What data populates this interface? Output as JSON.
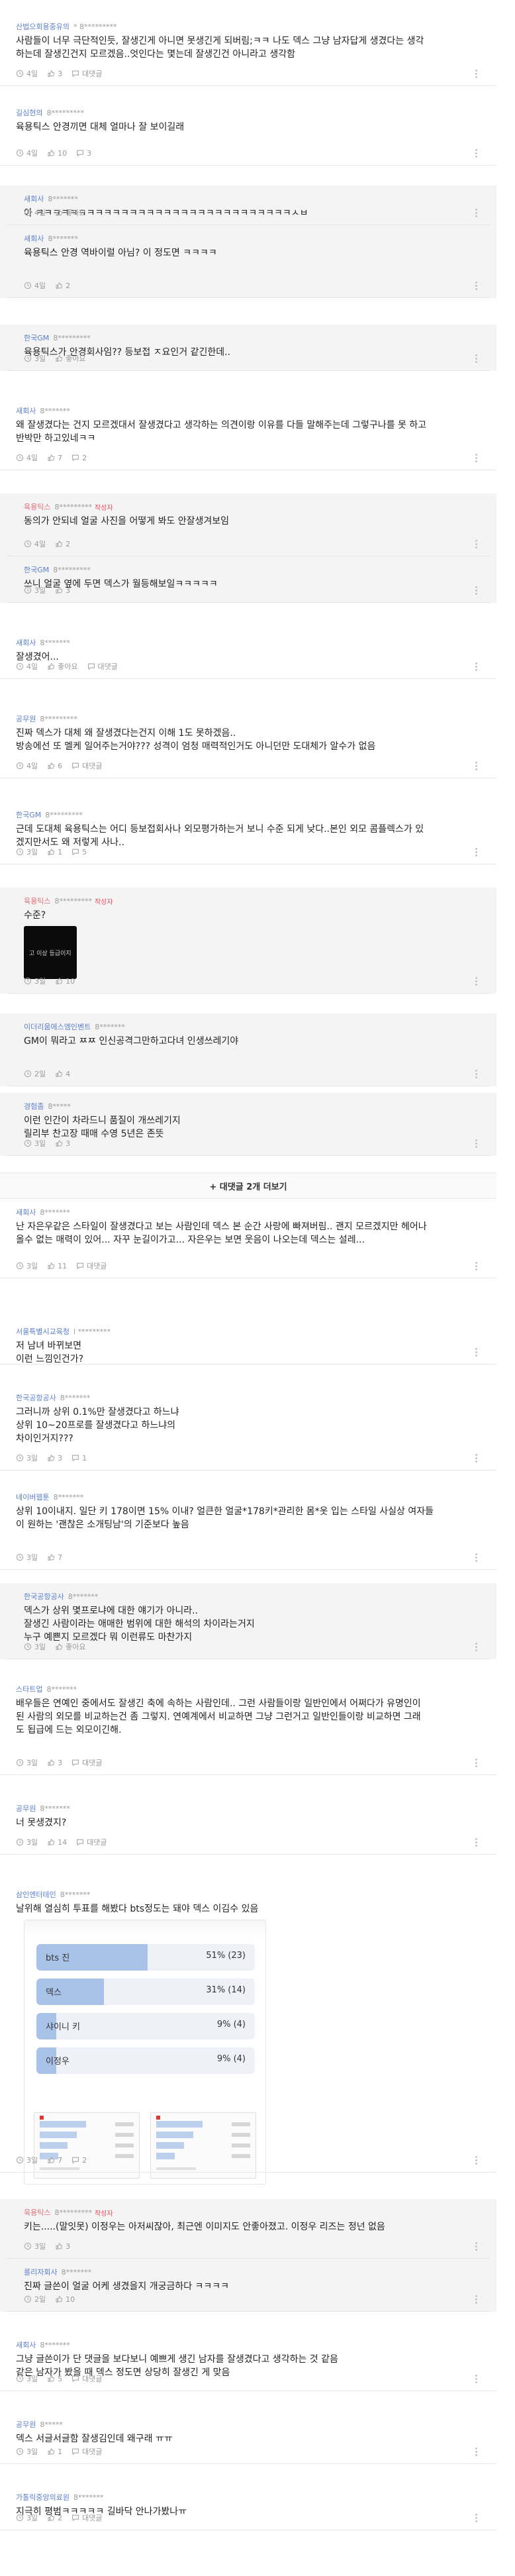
{
  "comments": [
    {
      "kind": "top",
      "nick": "산법으회용중유의",
      "memo": "* 8*********",
      "text": [
        "사람들이 너무 극단적인듯, 잘생긴게 아니면 못생긴게 되버림;ㅋㅋ 나도 덱스 그냥 남자답게 생겼다는 생각",
        "하는데 잘생긴건지 모르겠음..엇인다는 몇는데 잘생긴건 아니라고 생각함"
      ],
      "meta": {
        "time": "4일",
        "likes": "3",
        "reply": "대댓글"
      }
    },
    {
      "kind": "top",
      "nick": "길심현의",
      "memo": "8*********",
      "text": [
        "육용틱스 안경끼면 대체 얼마나 잘 보이길래"
      ],
      "meta": {
        "time": "4일",
        "likes": "10",
        "reply": "3"
      }
    },
    {
      "kind": "reply",
      "nick": "새회사",
      "memo": "8*******",
      "text": [
        "아 ㅋㅋㅋㅋㅋㅋㅋㅋㅋㅋㅋㅋㅋㅋㅋㅋㅋㅋㅋㅋㅋㅋㅋㅋㅋㅋㅋㅋㅋㅋㅅㅂ"
      ],
      "meta": {
        "time": "4일",
        "likes": "좋아요",
        "reply": ""
      }
    },
    {
      "kind": "reply",
      "nick": "새회사",
      "memo": "8*******",
      "text": [
        "육용틱스 안경 역바이럴 아님? 이 정도면 ㅋㅋㅋㅋ"
      ],
      "meta": {
        "time": "4일",
        "likes": "2",
        "reply": ""
      }
    },
    {
      "kind": "reply",
      "nick": "한국GM",
      "memo": "8*********",
      "text": [
        "육용틱스가 안경회사임?? 등보접 ㅈ요인거 같긴한데.."
      ],
      "meta": {
        "time": "3일",
        "likes": "좋아요",
        "reply": ""
      }
    },
    {
      "kind": "top",
      "nick": "새회사",
      "memo": "8*******",
      "text": [
        "왜 잘생겼다는 건지 모르겠대서 잘생겼다고 생각하는 의견이랑 이유를 다들 말해주는데 그렇구나를 못 하고",
        "반박만 하고있네ㅋㅋ"
      ],
      "meta": {
        "time": "4일",
        "likes": "7",
        "reply": "2"
      }
    },
    {
      "kind": "reply",
      "nick": "육용틱스",
      "memo": "8*********",
      "tag": "작성자",
      "text": [
        "동의가 안되네 얼굴 사진을 어떻게 봐도 안잘생겨보임"
      ],
      "meta": {
        "time": "4일",
        "likes": "2",
        "reply": ""
      }
    },
    {
      "kind": "reply",
      "nick": "한국GM",
      "memo": "8*********",
      "text": [
        "쓰니 얼굴 옆에 두면 덱스가 월등해보일ㅋㅋㅋㅋㅋ"
      ],
      "meta": {
        "time": "3일",
        "likes": "3",
        "reply": ""
      }
    },
    {
      "kind": "top",
      "nick": "새회사",
      "memo": "8*******",
      "text": [
        "잘생겼어..."
      ],
      "meta": {
        "time": "4일",
        "likes": "좋아요",
        "reply": "대댓글"
      }
    },
    {
      "kind": "top",
      "nick": "공무원",
      "memo": "8*********",
      "text": [
        "진짜 덱스가 대체 왜 잘생겼다는건지 이해 1도 못하겠음..",
        "방송에선 또 멜케 일어주는거야??? 성격이 엄청 매력적인거도 아니던만 도대체가 알수가 없음"
      ],
      "meta": {
        "time": "4일",
        "likes": "6",
        "reply": "대댓글"
      }
    },
    {
      "kind": "top",
      "nick": "한국GM",
      "memo": "8*********",
      "text": [
        "근데 도대체 육용틱스는 어디 등보접회사나 외모평가하는거 보니 수준 되게 낮다..본인 외모 콤플렉스가 있",
        "겠지만서도 왜 저렇게 사나.."
      ],
      "meta": {
        "time": "3일",
        "likes": "1",
        "reply": "5"
      }
    },
    {
      "kind": "reply",
      "nick": "육용틱스",
      "memo": "8*********",
      "tag": "작성자",
      "text": [
        "수준?"
      ],
      "image": "고 이상 등급이지",
      "meta": {
        "time": "3일",
        "likes": "10",
        "reply": ""
      }
    },
    {
      "kind": "reply",
      "nick": "이더리움에스엠인벤트",
      "memo": "8*******",
      "text": [
        "GM이 뭐라고 ㅉㅉ 인신공격그만하고다녀 인생쓰레기야"
      ],
      "meta": {
        "time": "2일",
        "likes": "4",
        "reply": ""
      }
    },
    {
      "kind": "reply",
      "nick": "경험좀",
      "memo": "8*****",
      "text": [
        "이런 인간이 차라드니 품질이 개쓰레기지",
        "릴리부 찬고장 때매 수영 5년은 존뜻"
      ],
      "meta": {
        "time": "3일",
        "likes": "3",
        "reply": ""
      }
    },
    {
      "kind": "top",
      "nick": "새회사",
      "memo": "8*******",
      "text": [
        "난 자은우같은 스타일이 잘생겼다고 보는 사람인데 덱스 본 순간 사랑에 빠져버림.. 괜지 모르겠지만 헤어나",
        "올수 없는 매력이 있어... 자꾸 눈길이가고... 자은우는 보면 웃음이 나오는데 덱스는 설레..."
      ],
      "meta": {
        "time": "3일",
        "likes": "11",
        "reply": "대댓글"
      }
    },
    {
      "kind": "top",
      "nick": "서울특별시교육청",
      "memo": "l *********",
      "text": [
        "저 남녀 바뀌보면",
        "이런 느낌인건가?"
      ],
      "meta": null
    },
    {
      "kind": "top",
      "nick": "한국공항공사",
      "memo": "8*******",
      "text": [
        "그러니까 상위 0.1%만 잘생겼다고 하느냐",
        "상위 10~20프로를 잘생겼다고 하느냐의",
        "차이인거지???"
      ],
      "meta": {
        "time": "3일",
        "likes": "3",
        "reply": "1"
      }
    },
    {
      "kind": "top",
      "nick": "네이버웹툰",
      "memo": "8*******",
      "text": [
        "상위 10이내지. 일단 키 178이면 15% 이내? 얼큰한 얼굴*178키*관리한 몸*옷 입는 스타일 사실상 여자들",
        "이 원하는 '괜찮은 소개팅남'의 기준보다 높음"
      ],
      "meta": {
        "time": "3일",
        "likes": "7",
        "reply": ""
      }
    },
    {
      "kind": "reply",
      "nick": "한국공항공사",
      "memo": "8*******",
      "text": [
        "덱스가 상위 몇프로냐에 대한 얘기가 아니라..",
        "잘생긴 사람이라는 애매한 범위에 대한 해석의 차이라는거지",
        "누구 예쁜지 모르겠다 뭐 이런류도 마찬가지"
      ],
      "meta": {
        "time": "3일",
        "likes": "좋아요",
        "reply": ""
      }
    },
    {
      "kind": "top",
      "nick": "스타트업",
      "memo": "8*******",
      "text": [
        "배우들은 연예인 중에서도 잘생긴 축에 속하는 사람인데.. 그런 사람들이랑 일반인에서 어쩌다가 유명인이",
        "된 사람의 외모를 비교하는건 좀 그렇지. 연예계에서 비교하면 그냥 그런거고 일반인들이랑 비교하면 그래",
        "도 됩급에 드는 외모이긴해."
      ],
      "meta": {
        "time": "3일",
        "likes": "3",
        "reply": "대댓글"
      }
    },
    {
      "kind": "top",
      "nick": "공무원",
      "memo": "8*******",
      "text": [
        "너 못생겼지?"
      ],
      "meta": {
        "time": "3일",
        "likes": "14",
        "reply": "대댓글"
      }
    },
    {
      "kind": "top",
      "nick": "삼인엔터테인",
      "memo": "8*******",
      "text": [
        "날위해 열심히 투표를 해봤다 bts정도는 돼야 덱스 이김수 있음"
      ],
      "poll": [
        {
          "label": "bts 진",
          "pct": "51% (23)",
          "value": 51
        },
        {
          "label": "덱스",
          "pct": "31% (14)",
          "value": 31
        },
        {
          "label": "샤이니 키",
          "pct": "9% (4)",
          "value": 9
        },
        {
          "label": "이정우",
          "pct": "9% (4)",
          "value": 9
        }
      ],
      "meta": {
        "time": "3일",
        "likes": "7",
        "reply": "2"
      }
    },
    {
      "kind": "reply",
      "nick": "육용틱스",
      "memo": "8*********",
      "tag": "작성자",
      "text": [
        "키는.....(말잇못) 이정우는 아저씨잖아, 최근엔 이미지도 안좋아졌고. 이정우 리즈는 정넌 없음"
      ],
      "meta": {
        "time": "3일",
        "likes": "3",
        "reply": ""
      }
    },
    {
      "kind": "reply",
      "nick": "롤리자회사",
      "memo": "8*******",
      "text": [
        "진짜 글쓴이 얼굴 어케 생겼을지 개궁금하다 ㅋㅋㅋㅋ"
      ],
      "meta": {
        "time": "2일",
        "likes": "10",
        "reply": ""
      }
    },
    {
      "kind": "top",
      "nick": "새회사",
      "memo": "8*******",
      "text": [
        "그냥 글쓴이가 단 댓글을 보다보니 예쁘게 생긴 남자를 잘생겼다고 생각하는 것 같음",
        "같은 남자가 봤을 때 덱스 정도면 상당히 잘생긴 게 맞음"
      ],
      "meta": {
        "time": "3일",
        "likes": "5",
        "reply": "대댓글"
      }
    },
    {
      "kind": "top",
      "nick": "공무원",
      "memo": "8*****",
      "text": [
        "덱스 서글서글함 잘생김인데 왜구래 ㅠㅠ"
      ],
      "meta": {
        "time": "3일",
        "likes": "1",
        "reply": "대댓글"
      }
    },
    {
      "kind": "top",
      "nick": "가톨릭중앙의료원",
      "memo": "8*******",
      "text": [
        "지극히 평범ㅋㅋㅋㅋㅋ 길바닥 안나가봤나ㅠ"
      ],
      "meta": {
        "time": "3일",
        "likes": "2",
        "reply": "대댓글"
      }
    }
  ],
  "more_replies_label": "+ 대댓글 2개 더보기"
}
